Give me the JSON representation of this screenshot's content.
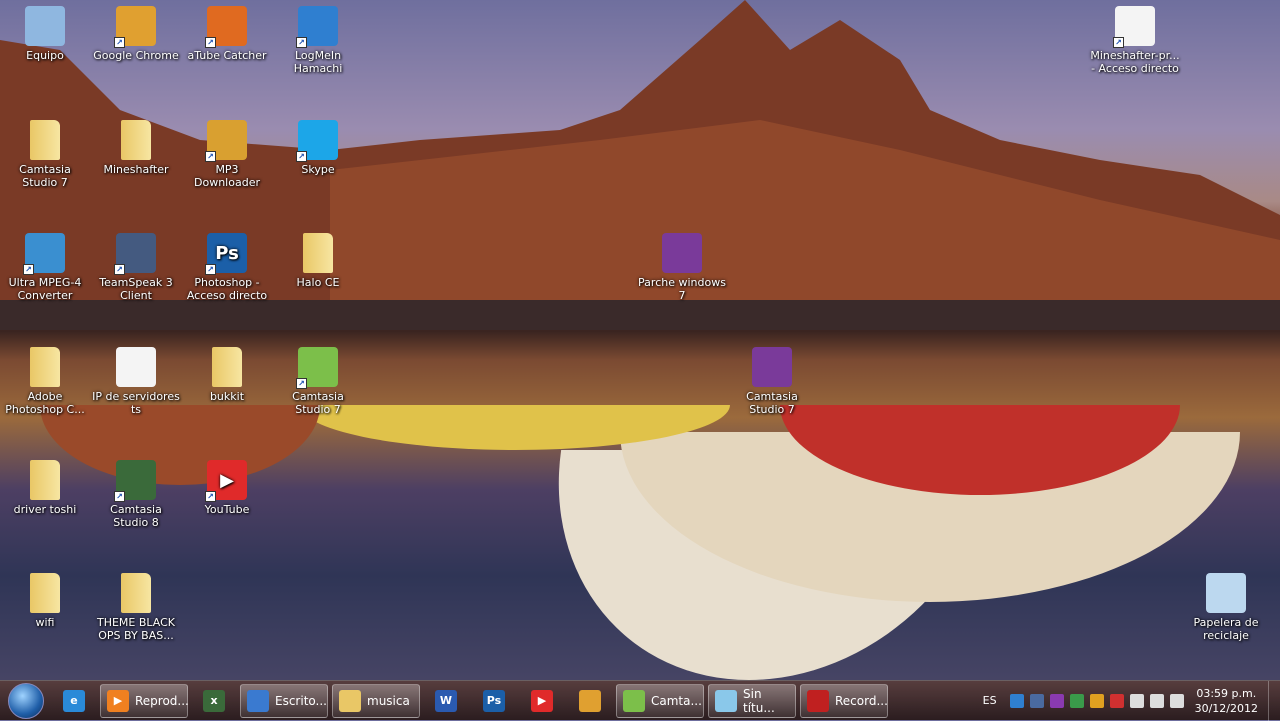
{
  "desktop_icons": [
    {
      "label": "Equipo",
      "icon": "computer-icon",
      "color": "#8fb7e0",
      "shortcut": false
    },
    {
      "label": "Google Chrome",
      "icon": "chrome-icon",
      "color": "#e0a030",
      "shortcut": true
    },
    {
      "label": "aTube Catcher",
      "icon": "atube-catcher-icon",
      "color": "#e06a20",
      "shortcut": true
    },
    {
      "label": "LogMeIn Hamachi",
      "icon": "hamachi-icon",
      "color": "#2f7fd0",
      "shortcut": true
    },
    {
      "label": "Camtasia Studio 7",
      "icon": "folder-icon",
      "folder": true
    },
    {
      "label": "Mineshafter",
      "icon": "folder-icon",
      "folder": true
    },
    {
      "label": "MP3 Downloader",
      "icon": "mp3-downloader-icon",
      "color": "#d9a030",
      "shortcut": true
    },
    {
      "label": "Skype",
      "icon": "skype-icon",
      "color": "#1ca6e8",
      "shortcut": true
    },
    {
      "label": "Ultra MPEG-4 Converter",
      "icon": "converter-icon",
      "color": "#3a8fd0",
      "shortcut": true
    },
    {
      "label": "TeamSpeak 3 Client",
      "icon": "teamspeak-icon",
      "color": "#445a80",
      "shortcut": true
    },
    {
      "label": "Photoshop - Acceso directo",
      "icon": "photoshop-icon",
      "color": "#1b5fa8",
      "shortcut": true,
      "glyph": "Ps"
    },
    {
      "label": "Halo CE",
      "icon": "folder-icon",
      "folder": true
    },
    {
      "label": "Parche windows 7",
      "icon": "winrar-icon",
      "color": "#7a3a9a"
    },
    {
      "label": "Adobe Photoshop C...",
      "icon": "folder-icon",
      "folder": true
    },
    {
      "label": "IP de servidores ts",
      "icon": "text-file-icon",
      "color": "#f4f4f4"
    },
    {
      "label": "bukkit",
      "icon": "folder-icon",
      "folder": true
    },
    {
      "label": "Camtasia Studio 7",
      "icon": "camtasia-icon",
      "color": "#7cbf4a",
      "shortcut": true
    },
    {
      "label": "Camtasia Studio 7",
      "icon": "winrar-icon",
      "color": "#7a3a9a"
    },
    {
      "label": "driver toshi",
      "icon": "folder-icon",
      "folder": true
    },
    {
      "label": "Camtasia Studio 8",
      "icon": "camtasia8-icon",
      "color": "#3a6a3a",
      "shortcut": true
    },
    {
      "label": "YouTube",
      "icon": "youtube-icon",
      "color": "#e02a2a",
      "shortcut": true,
      "glyph": "▶"
    },
    {
      "label": "wifi",
      "icon": "folder-icon",
      "folder": true
    },
    {
      "label": "THEME BLACK OPS BY BAS...",
      "icon": "folder-icon",
      "folder": true
    },
    {
      "label": "Mineshafter-pr... - Acceso directo",
      "icon": "java-file-icon",
      "color": "#f4f4f4",
      "shortcut": true
    },
    {
      "label": "Papelera de reciclaje",
      "icon": "recycle-bin-icon",
      "color": "#bcd8ef"
    }
  ],
  "taskbar": {
    "items": [
      {
        "label": "",
        "icon": "internet-explorer-icon",
        "color": "#2a8ad8",
        "glyph": "e",
        "type": "pin"
      },
      {
        "label": "Reprod...",
        "icon": "media-player-icon",
        "color": "#f08020",
        "glyph": "▶",
        "type": "win"
      },
      {
        "label": "",
        "icon": "camtasia8-icon",
        "color": "#3a6a3a",
        "glyph": "x",
        "type": "pin"
      },
      {
        "label": "Escrito...",
        "icon": "desktop-icon",
        "color": "#3a7ad0",
        "type": "win"
      },
      {
        "label": "musica",
        "icon": "folder-icon",
        "color": "#e9c766",
        "type": "win"
      },
      {
        "label": "",
        "icon": "word-icon",
        "color": "#2a5ab0",
        "glyph": "W",
        "type": "pin"
      },
      {
        "label": "",
        "icon": "photoshop-icon",
        "color": "#1b5fa8",
        "glyph": "Ps",
        "type": "pin"
      },
      {
        "label": "",
        "icon": "youtube-icon",
        "color": "#e02a2a",
        "glyph": "▶",
        "type": "pin"
      },
      {
        "label": "",
        "icon": "chrome-icon",
        "color": "#e0a030",
        "type": "pin"
      },
      {
        "label": "Camta...",
        "icon": "camtasia-icon",
        "color": "#7cbf4a",
        "type": "win"
      },
      {
        "label": "Sin títu...",
        "icon": "notepad-icon",
        "color": "#8ac8ea",
        "type": "win"
      },
      {
        "label": "Record...",
        "icon": "recorder-icon",
        "color": "#c02020",
        "type": "win"
      }
    ],
    "language": "ES",
    "tray_icons": [
      {
        "icon": "hamachi-tray-icon",
        "color": "#2f7fd0"
      },
      {
        "icon": "teamviewer-tray-icon",
        "color": "#4a6aa0"
      },
      {
        "icon": "onenote-tray-icon",
        "color": "#8a3ab0"
      },
      {
        "icon": "network-tray-icon",
        "color": "#3a9a4a"
      },
      {
        "icon": "update-tray-icon",
        "color": "#e0a020"
      },
      {
        "icon": "action-center-flag-icon",
        "color": "#d03030"
      },
      {
        "icon": "power-plug-icon",
        "color": "#dddddd"
      },
      {
        "icon": "signal-icon",
        "color": "#dddddd"
      },
      {
        "icon": "volume-icon",
        "color": "#dddddd"
      }
    ],
    "time": "03:59 p.m.",
    "date": "30/12/2012"
  }
}
